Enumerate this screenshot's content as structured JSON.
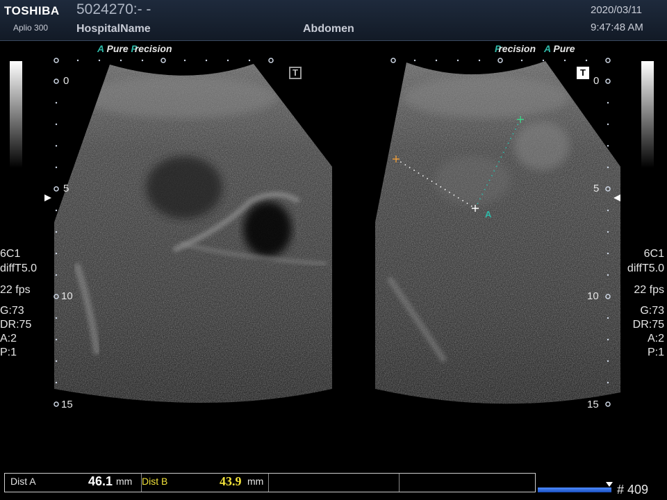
{
  "header": {
    "brand": "TOSHIBA",
    "model": "Aplio 300",
    "patient_id": "5024270:- -",
    "hospital": "HospitalName",
    "exam": "Abdomen",
    "date": "2020/03/11",
    "time": "9:47:48 AM"
  },
  "left_panel": {
    "preset_a": "A",
    "preset_pure": "Pure",
    "preset_p": "P",
    "preset_recision": "recision",
    "depth_marks": [
      "0",
      "5",
      "10",
      "15"
    ],
    "params": [
      "6C1",
      "diffT5.0",
      "22 fps",
      "G:73",
      "DR:75",
      "A:2",
      "P:1"
    ],
    "tmarker": "T"
  },
  "right_panel": {
    "preset_p": "P",
    "preset_recision": "recision",
    "preset_a": "A",
    "preset_pure": "Pure",
    "depth_marks": [
      "0",
      "5",
      "10",
      "15"
    ],
    "params": [
      "6C1",
      "diffT5.0",
      "22 fps",
      "G:73",
      "DR:75",
      "A:2",
      "P:1"
    ],
    "tmarker": "T",
    "caliper_label": "A"
  },
  "measurements": {
    "dist_a_label": "Dist A",
    "dist_a_value": "46.1",
    "dist_a_unit": "mm",
    "dist_b_label": "Dist B",
    "dist_b_value": "43.9",
    "dist_b_unit": "mm"
  },
  "cine": {
    "frame": "# 409"
  },
  "colors": {
    "accent_teal": "#2fb9a8",
    "dist_b_yellow": "#f2e23a",
    "caliper_orange": "#e89a3a",
    "caliper_green": "#3fd48a"
  }
}
